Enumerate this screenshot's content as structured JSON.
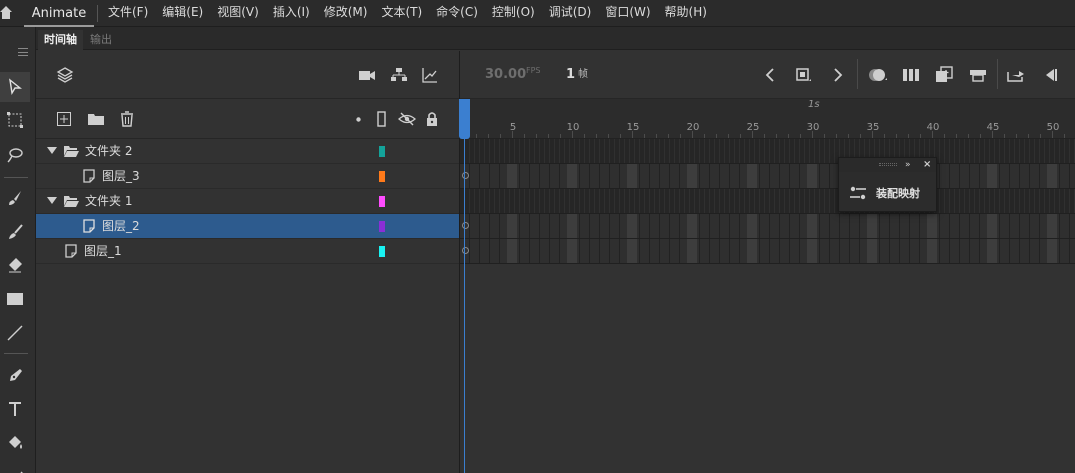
{
  "menubar": {
    "app_title": "Animate",
    "items": [
      "文件(F)",
      "编辑(E)",
      "视图(V)",
      "插入(I)",
      "修改(M)",
      "文本(T)",
      "命令(C)",
      "控制(O)",
      "调试(D)",
      "窗口(W)",
      "帮助(H)"
    ]
  },
  "panel_tabs": {
    "timeline": "时间轴",
    "output": "输出"
  },
  "timeline": {
    "fps_value": "30.00",
    "fps_unit": "FPS",
    "current_frame": "1",
    "frame_unit": "帧",
    "ruler_second_label": "1s",
    "ruler_numbers": [
      "5",
      "10",
      "15",
      "20",
      "25",
      "30",
      "35",
      "40",
      "45",
      "50"
    ]
  },
  "layers": [
    {
      "name": "文件夹 2",
      "type": "folder",
      "color": "#14a39a"
    },
    {
      "name": "图层_3",
      "type": "layer",
      "color": "#ff7a1a"
    },
    {
      "name": "文件夹 1",
      "type": "folder",
      "color": "#ff4cff"
    },
    {
      "name": "图层_2",
      "type": "layer",
      "color": "#8a2fd6",
      "selected": true
    },
    {
      "name": "图层_1",
      "type": "layer",
      "color": "#19f2f2"
    }
  ],
  "floating_panel": {
    "item_label": "装配映射"
  },
  "colors": {
    "selection": "#2d5b8e",
    "playhead": "#3b7fd0"
  }
}
